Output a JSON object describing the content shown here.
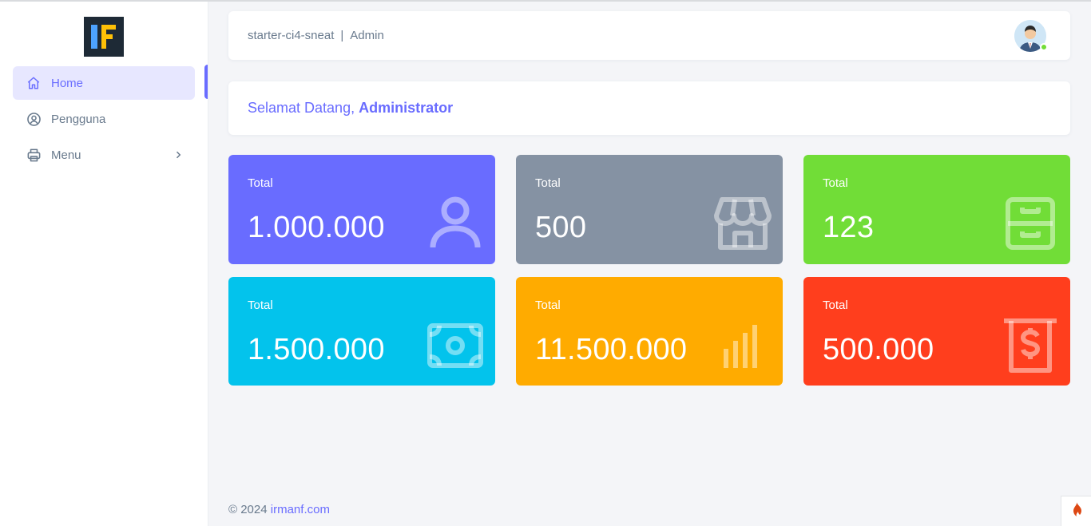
{
  "app": {
    "name": "starter-ci4-sneat",
    "role": "Admin"
  },
  "sidebar": {
    "items": [
      {
        "label": "Home",
        "icon": "home-icon",
        "active": true
      },
      {
        "label": "Pengguna",
        "icon": "user-circle-icon",
        "active": false
      },
      {
        "label": "Menu",
        "icon": "printer-icon",
        "active": false,
        "has_submenu": true
      }
    ]
  },
  "welcome": {
    "greeting": "Selamat Datang,",
    "name": "Administrator"
  },
  "cards": [
    {
      "label": "Total",
      "value": "1.000.000",
      "color": "#696cff",
      "icon": "user-icon"
    },
    {
      "label": "Total",
      "value": "500",
      "color": "#8592a3",
      "icon": "store-icon"
    },
    {
      "label": "Total",
      "value": "123",
      "color": "#71dd37",
      "icon": "cabinet-icon"
    },
    {
      "label": "Total",
      "value": "1.500.000",
      "color": "#03c3ec",
      "icon": "money-icon"
    },
    {
      "label": "Total",
      "value": "11.500.000",
      "color": "#ffab00",
      "icon": "bar-chart-icon"
    },
    {
      "label": "Total",
      "value": "500.000",
      "color": "#ff3e1d",
      "icon": "dollar-bill-icon"
    }
  ],
  "footer": {
    "copyright": "© 2024",
    "link": "irmanf.com"
  },
  "colors": {
    "primary": "#696cff",
    "text": "#697a8d",
    "background": "#f4f5f8"
  }
}
